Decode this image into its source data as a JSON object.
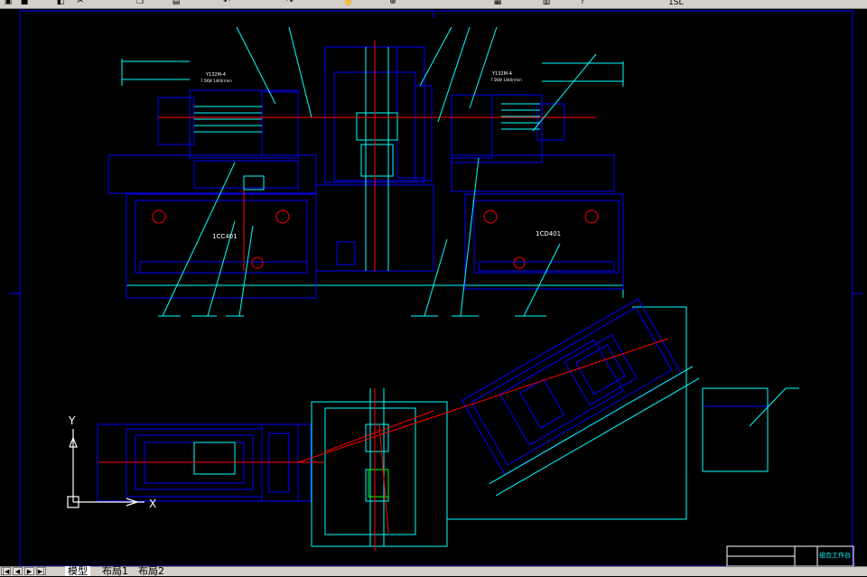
{
  "toolbar": {
    "icons": [
      "open-icon",
      "save-icon",
      "print-icon",
      "cut-icon",
      "copy-icon",
      "paste-icon",
      "undo-icon",
      "redo-icon",
      "pan-icon",
      "zoom-icon",
      "properties-icon",
      "layer-icon",
      "help-icon"
    ],
    "right_text": "1SL"
  },
  "drawing": {
    "labels": {
      "left_unit": "1CC401",
      "right_unit": "1CD401",
      "title_block": "组合工作台",
      "motor_left": "Y132M-4",
      "motor_left_spec": "7.5KW 1440r/min",
      "motor_right": "Y132M-4",
      "motor_right_spec": "7.5KW 1440r/min"
    },
    "ucs": {
      "y_label": "Y",
      "x_label": "X"
    }
  },
  "tabs": [
    {
      "label": "模型",
      "active": true
    },
    {
      "label": "布局1",
      "active": false
    },
    {
      "label": "布局2",
      "active": false
    }
  ],
  "colors": {
    "background": "#000000",
    "blue": "#0000ff",
    "cyan": "#00ffff",
    "red": "#ff0000",
    "white": "#ffffff",
    "green": "#00ff00"
  }
}
